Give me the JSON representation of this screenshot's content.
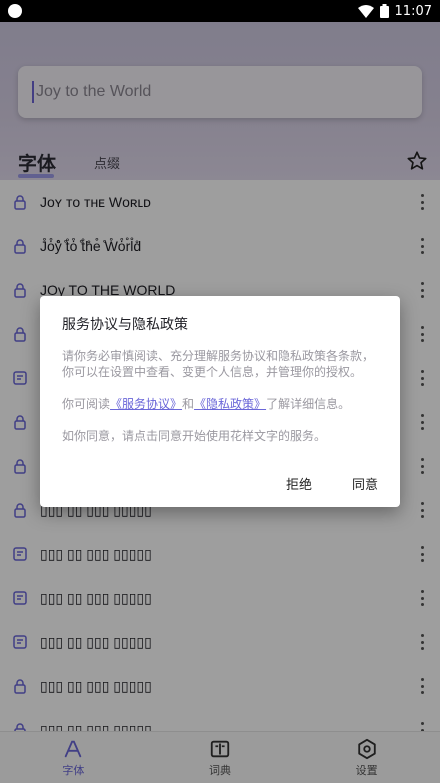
{
  "status": {
    "time": "11:07"
  },
  "search": {
    "text": "Joy to the World"
  },
  "tabs": {
    "active": "字体",
    "second": "点缀"
  },
  "list": [
    {
      "icon": "lock-icon",
      "text": "Jᴏʏ ᴛᴏ ᴛʜᴇ Wᴏʀʟᴅ"
    },
    {
      "icon": "lock-icon",
      "text": "J̊ȯ̊ẙ̊ ̊t̊ȯ̊ ̊t̊h̊e̊ ̊W̊ȯ̊r̊l̊d̊"
    },
    {
      "icon": "lock-icon",
      "text": "JOy TO THE WORLD"
    },
    {
      "icon": "lock-icon",
      "text": ""
    },
    {
      "icon": "document-icon",
      "text": ""
    },
    {
      "icon": "lock-icon",
      "text": ""
    },
    {
      "icon": "lock-icon",
      "text": ""
    },
    {
      "icon": "lock-icon",
      "text": "▯▯▯ ▯▯ ▯▯▯ ▯▯▯▯▯"
    },
    {
      "icon": "document-icon",
      "text": "▯▯▯ ▯▯ ▯▯▯ ▯▯▯▯▯"
    },
    {
      "icon": "document-icon",
      "text": "▯▯▯ ▯▯ ▯▯▯ ▯▯▯▯▯"
    },
    {
      "icon": "document-icon",
      "text": "▯▯▯ ▯▯ ▯▯▯ ▯▯▯▯▯"
    },
    {
      "icon": "lock-icon",
      "text": "▯▯▯ ▯▯ ▯▯▯ ▯▯▯▯▯"
    },
    {
      "icon": "lock-icon",
      "text": "▯▯▯ ▯▯ ▯▯▯ ▯▯▯▯▯"
    }
  ],
  "nav": [
    {
      "label": "字体",
      "icon": "font-icon"
    },
    {
      "label": "词典",
      "icon": "book-icon"
    },
    {
      "label": "设置",
      "icon": "settings-icon"
    }
  ],
  "dialog": {
    "title": "服务协议与隐私政策",
    "p1": "请你务必审慎阅读、充分理解服务协议和隐私政策各条款，你可以在设置中查看、变更个人信息，并管理你的授权。",
    "p2_prefix": "你可阅读",
    "link1": "《服务协议》",
    "p2_and": "和",
    "link2": "《隐私政策》",
    "p2_suffix": "了解详细信息。",
    "p3": "如你同意，请点击同意开始使用花样文字的服务。",
    "reject": "拒绝",
    "agree": "同意"
  },
  "colors": {
    "accent": "#6a66d8",
    "header_top": "#cfcae3"
  }
}
